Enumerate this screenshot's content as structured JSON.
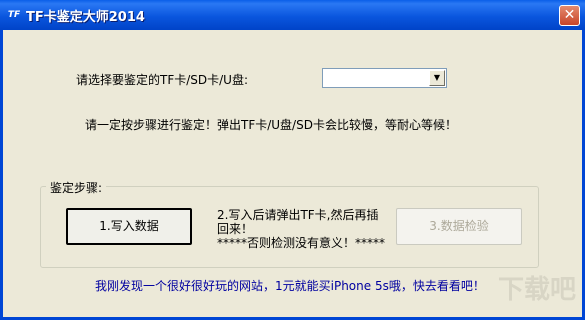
{
  "window": {
    "title": "TF卡鉴定大师2014",
    "icon_label": "TF",
    "close_glyph": "✕"
  },
  "select_prompt": "请选择要鉴定的TF卡/SD卡/U盘:",
  "drive_select": {
    "value": "",
    "arrow": "▼"
  },
  "warning": "请一定按步骤进行鉴定！弹出TF卡/U盘/SD卡会比较慢，等耐心等候！",
  "steps_group": {
    "title": "鉴定步骤:",
    "write_button": "1.写入数据",
    "note_line1": "2.写入后请弹出TF卡,然后再插回来！",
    "note_line2": "*****否则检测没有意义！*****",
    "check_button": "3.数据检验"
  },
  "footer_link": "我刚发现一个很好很好玩的网站，1元就能买iPhone 5s哦，快去看看吧！",
  "watermark": "下载吧"
}
